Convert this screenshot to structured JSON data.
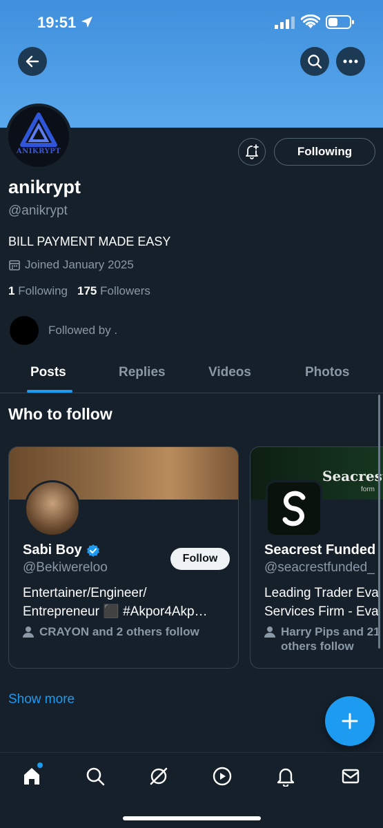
{
  "status_bar": {
    "time": "19:51"
  },
  "profile": {
    "avatar_text": "ANIKRYPT",
    "name": "anikrypt",
    "handle": "@anikrypt",
    "bio": "BILL PAYMENT MADE EASY",
    "joined": "Joined January 2025",
    "following_count": "1",
    "following_label": "Following",
    "followers_count": "175",
    "followers_label": "Followers",
    "followed_by": "Followed by ."
  },
  "actions": {
    "following_button": "Following"
  },
  "tabs": [
    {
      "label": "Posts",
      "active": true
    },
    {
      "label": "Replies",
      "active": false
    },
    {
      "label": "Videos",
      "active": false
    },
    {
      "label": "Photos",
      "active": false
    }
  ],
  "who_to_follow": {
    "title": "Who to follow",
    "cards": [
      {
        "name": "Sabi Boy",
        "verified": true,
        "handle": "@Bekiwereloo",
        "bio_line1": "Entertainer/Engineer/",
        "bio_line2": "Entrepreneur ⬛ #Akpor4Akp…",
        "social": "CRAYON and 2 others follow",
        "follow_label": "Follow"
      },
      {
        "name": "Seacrest Funded",
        "handle": "@seacrestfunded_",
        "banner_text": "SeacrestFu",
        "banner_sub": "form",
        "bio_line1": "Leading Trader Eva",
        "bio_line2": "Services Firm - Eva",
        "social": "Harry Pips and 21 others follow"
      }
    ],
    "show_more": "Show more"
  },
  "colors": {
    "accent": "#1d9bf0",
    "background": "#15202b",
    "banner": "#4f9de6"
  }
}
